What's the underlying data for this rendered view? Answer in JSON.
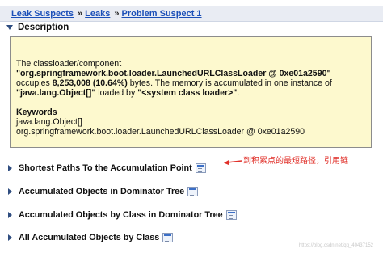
{
  "breadcrumb": {
    "items": [
      "Leak Suspects",
      "Problem Suspect 1"
    ],
    "items_alt": "Leaks",
    "separator": "»"
  },
  "description": {
    "heading": "Description",
    "line1": "The classloader/component",
    "line2": "\"org.springframework.boot.loader.LaunchedURLClassLoader @ 0xe01a2590\"",
    "line3_prefix": "occupies ",
    "line3_bold": "8,253,008 (10.64%)",
    "line3_suffix": " bytes. The memory is accumulated in one instance of",
    "line4_bold1": "\"java.lang.Object[]\"",
    "line4_mid": " loaded by ",
    "line4_bold2": "\"<system class loader>\"",
    "line4_end": ".",
    "keywords_heading": "Keywords",
    "keywords": [
      "java.lang.Object[]",
      "org.springframework.boot.loader.LaunchedURLClassLoader @ 0xe01a2590"
    ]
  },
  "sections": [
    "Shortest Paths To the Accumulation Point",
    "Accumulated Objects in Dominator Tree",
    "Accumulated Objects by Class in Dominator Tree",
    "All Accumulated Objects by Class"
  ],
  "annotation": {
    "text": "到积累点的最短路径，引用链",
    "color": "#e0302a"
  },
  "watermark": "https://blog.csdn.net/qq_40437152",
  "colors": {
    "link": "#1b4fb8",
    "breadcrumb_bg": "#e9ecf3",
    "box_bg": "#fdf9ce",
    "twisty": "#2f4d80"
  }
}
